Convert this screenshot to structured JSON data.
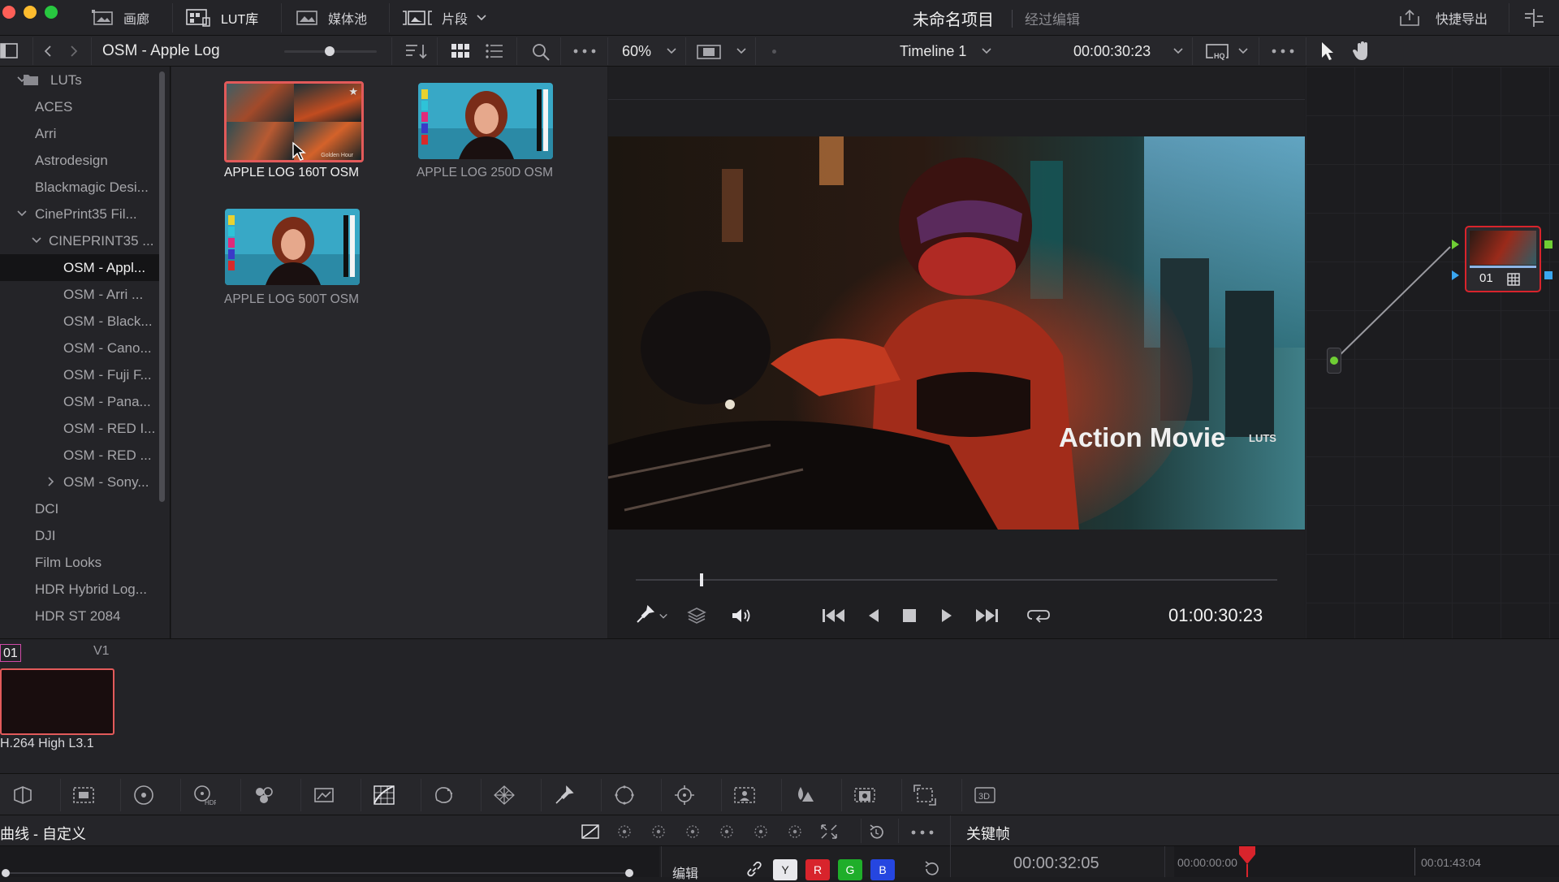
{
  "titlebar": {
    "pages": [
      {
        "label": "画廊",
        "icon": "gallery-icon"
      },
      {
        "label": "LUT库",
        "icon": "lut-library-icon"
      },
      {
        "label": "媒体池",
        "icon": "media-pool-icon"
      },
      {
        "label": "片段",
        "icon": "clips-icon"
      }
    ],
    "project_title": "未命名项目",
    "project_status": "经过编辑",
    "quick_export": "快捷导出"
  },
  "toolbar": {
    "album": "OSM - Apple Log",
    "zoom": "60%",
    "timeline": "Timeline 1",
    "timecode": "00:00:30:23"
  },
  "sidebar": {
    "items": [
      {
        "label": "LUTs",
        "depth": 0,
        "expanded": true,
        "folder": true
      },
      {
        "label": "ACES",
        "depth": 1
      },
      {
        "label": "Arri",
        "depth": 1
      },
      {
        "label": "Astrodesign",
        "depth": 1
      },
      {
        "label": "Blackmagic Desi...",
        "depth": 1
      },
      {
        "label": "CinePrint35 Fil...",
        "depth": 1,
        "expanded": true
      },
      {
        "label": "CINEPRINT35 ...",
        "depth": 2,
        "expanded": true
      },
      {
        "label": "OSM - Appl...",
        "depth": 3,
        "selected": true
      },
      {
        "label": "OSM - Arri ...",
        "depth": 3
      },
      {
        "label": "OSM - Black...",
        "depth": 3
      },
      {
        "label": "OSM - Cano...",
        "depth": 3
      },
      {
        "label": "OSM - Fuji F...",
        "depth": 3
      },
      {
        "label": "OSM - Pana...",
        "depth": 3
      },
      {
        "label": "OSM - RED I...",
        "depth": 3
      },
      {
        "label": "OSM - RED ...",
        "depth": 3
      },
      {
        "label": "OSM - Sony...",
        "depth": 3,
        "collapsed": true
      },
      {
        "label": "DCI",
        "depth": 1
      },
      {
        "label": "DJI",
        "depth": 1
      },
      {
        "label": "Film Looks",
        "depth": 1
      },
      {
        "label": "HDR Hybrid Log...",
        "depth": 1
      },
      {
        "label": "HDR ST 2084",
        "depth": 1
      }
    ]
  },
  "luts": [
    {
      "label": "APPLE LOG 160T OSM",
      "selected": true,
      "thumb_caption": "Golden Hour"
    },
    {
      "label": "APPLE LOG 250D OSM"
    },
    {
      "label": "APPLE LOG 500T OSM"
    }
  ],
  "viewer": {
    "watermark_title": "Action Movie",
    "watermark_brand": "LUTS",
    "playhead_timecode": "01:00:30:23",
    "scrub_position": 0.1
  },
  "node": {
    "label": "01"
  },
  "clip": {
    "number": "01",
    "track": "V1",
    "codec": "H.264 High L3.1"
  },
  "bottom": {
    "panel_title": "曲线 - 自定义",
    "edit_label": "编辑",
    "channels": [
      "Y",
      "R",
      "G",
      "B"
    ],
    "keyframes_title": "关键帧",
    "kf_timecode": "00:00:32:05",
    "ruler_start": "00:00:00:00",
    "ruler_end": "00:01:43:04"
  },
  "colors": {
    "selection": "#e25a5a",
    "accent_red": "#d8242c",
    "node_green": "#6fce34",
    "channel_g": "#1fae2a",
    "channel_b": "#2546e0"
  }
}
